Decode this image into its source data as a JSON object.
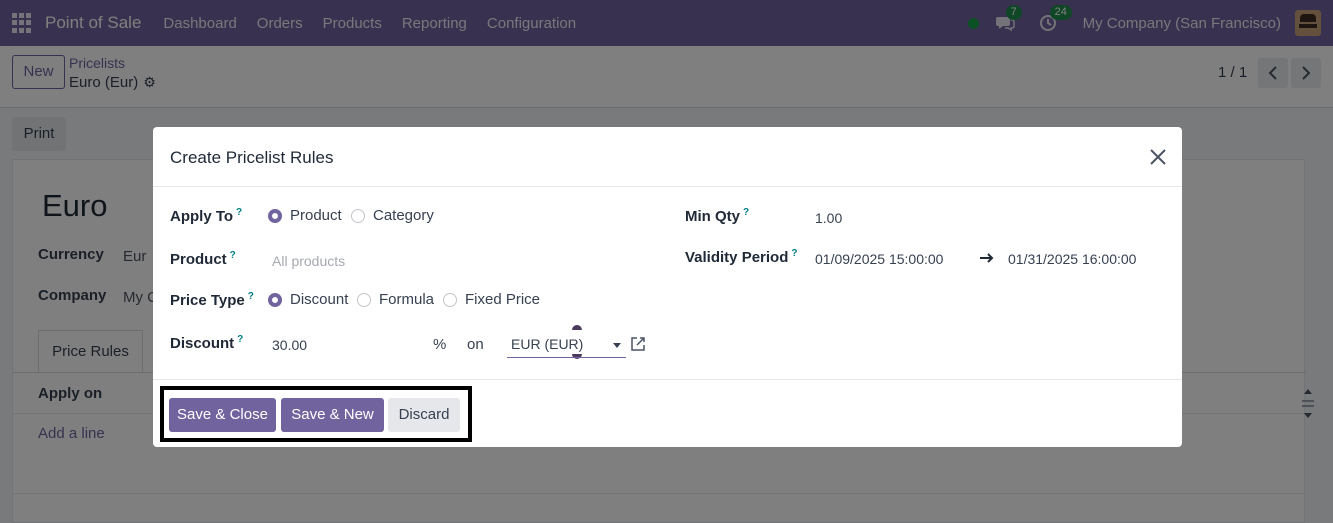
{
  "navbar": {
    "app_name": "Point of Sale",
    "menu": [
      "Dashboard",
      "Orders",
      "Products",
      "Reporting",
      "Configuration"
    ],
    "messages_count": "7",
    "activities_count": "24",
    "company": "My Company (San Francisco)"
  },
  "control": {
    "new_label": "New",
    "breadcrumb_parent": "Pricelists",
    "breadcrumb_current": "Euro (Eur)",
    "pager": "1 / 1"
  },
  "form": {
    "print_label": "Print",
    "title": "Euro",
    "currency_label": "Currency",
    "currency_value": "Eur",
    "company_label": "Company",
    "company_value": "My C",
    "tab_price_rules": "Price Rules",
    "col_apply_on": "Apply on",
    "add_line": "Add a line"
  },
  "dialog": {
    "title": "Create Pricelist Rules",
    "apply_to_label": "Apply To",
    "apply_to_options": [
      "Product",
      "Category"
    ],
    "apply_to_selected": "Product",
    "product_label": "Product",
    "product_placeholder": "All products",
    "price_type_label": "Price Type",
    "price_type_options": [
      "Discount",
      "Formula",
      "Fixed Price"
    ],
    "price_type_selected": "Discount",
    "discount_label": "Discount",
    "discount_value": "30.00",
    "percent_symbol": "%",
    "on_label": "on",
    "base_currency": "EUR (EUR)",
    "min_qty_label": "Min Qty",
    "min_qty_value": "1.00",
    "validity_label": "Validity Period",
    "validity_start": "01/09/2025 15:00:00",
    "validity_end": "01/31/2025 16:00:00",
    "help_mark": "?",
    "buttons": {
      "save_close": "Save & Close",
      "save_new": "Save & New",
      "discard": "Discard"
    }
  },
  "colors": {
    "brand": "#71639e",
    "badge": "#1e8f4e",
    "status_online": "#16a34a"
  }
}
